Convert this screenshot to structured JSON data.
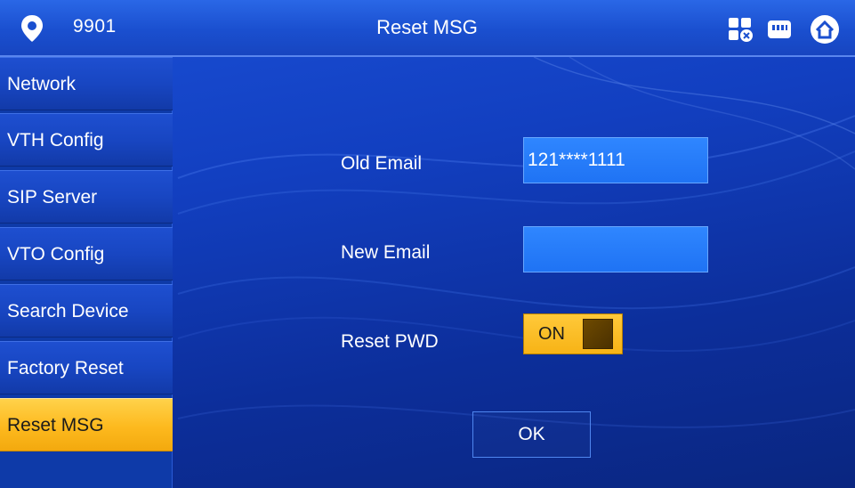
{
  "header": {
    "room_number": "9901",
    "title": "Reset MSG",
    "icons": [
      "location-pin-icon",
      "network-status-icon",
      "card-icon",
      "home-icon"
    ]
  },
  "sidebar": {
    "items": [
      {
        "label": "Network"
      },
      {
        "label": "VTH Config"
      },
      {
        "label": "SIP Server"
      },
      {
        "label": "VTO Config"
      },
      {
        "label": "Search Device"
      },
      {
        "label": "Factory Reset"
      },
      {
        "label": "Reset MSG",
        "active": true
      }
    ]
  },
  "form": {
    "old_email_label": "Old Email",
    "old_email_value": "121****1111",
    "new_email_label": "New Email",
    "new_email_value": "",
    "reset_pwd_label": "Reset PWD",
    "reset_pwd_state": "ON",
    "ok_label": "OK"
  },
  "colors": {
    "background": "#123fc0",
    "accent": "#fdb91e",
    "field": "#1f73f4"
  }
}
